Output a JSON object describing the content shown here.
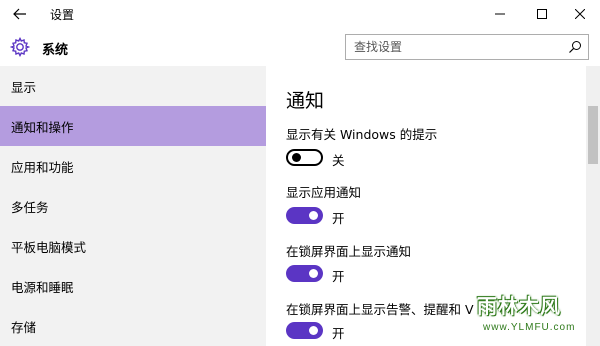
{
  "window": {
    "title": "设置",
    "controls": [
      "minimize-icon",
      "maximize-icon",
      "close-icon"
    ]
  },
  "header": {
    "app_title": "系统",
    "search_placeholder": "查找设置"
  },
  "sidebar": {
    "items": [
      {
        "label": "显示",
        "selected": false
      },
      {
        "label": "通知和操作",
        "selected": true
      },
      {
        "label": "应用和功能",
        "selected": false
      },
      {
        "label": "多任务",
        "selected": false
      },
      {
        "label": "平板电脑模式",
        "selected": false
      },
      {
        "label": "电源和睡眠",
        "selected": false
      },
      {
        "label": "存储",
        "selected": false
      }
    ]
  },
  "main": {
    "heading": "通知",
    "settings": [
      {
        "label": "显示有关 Windows 的提示",
        "state": "关",
        "on": false
      },
      {
        "label": "显示应用通知",
        "state": "开",
        "on": true
      },
      {
        "label": "在锁屏界面上显示通知",
        "state": "开",
        "on": true
      },
      {
        "label": "在锁屏界面上显示告警、提醒和 V",
        "state": "开",
        "on": true
      }
    ]
  },
  "watermark": {
    "text": "雨林木风",
    "url": "www.YLMFU.com"
  },
  "colors": {
    "accent": "#5b35c4",
    "selected_bg": "#b49cdf",
    "sidebar_bg": "#f2f2f2"
  }
}
